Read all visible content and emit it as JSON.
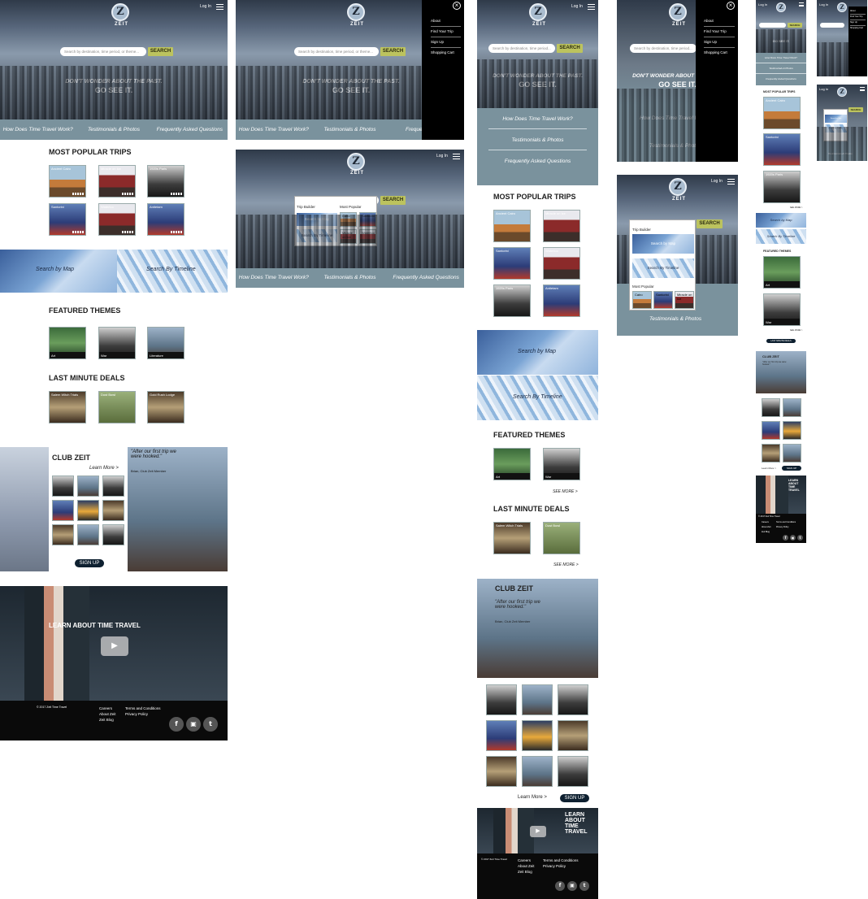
{
  "brand": {
    "logo_letter": "Z",
    "name": "ZEIT"
  },
  "header": {
    "login": "Log In"
  },
  "search": {
    "placeholder": "Search by destination, time period, or theme...",
    "placeholder_short": "Search by destination, time period...",
    "button": "SEARCH"
  },
  "hero": {
    "line1": "DON'T WONDER ABOUT THE PAST.",
    "line2": "GO SEE IT."
  },
  "nav": {
    "how": "How Does Time Travel Work?",
    "testimonials": "Testimonials & Photos",
    "faq": "Frequently Asked Questions",
    "faq_short": "Frequently Asked"
  },
  "menu": {
    "items": [
      "About",
      "Find Your Trip",
      "Sign Up",
      "Shopping Cart"
    ],
    "close": "×"
  },
  "dropdown": {
    "builder": "Trip Builder",
    "popular": "Most Popular",
    "by_map": "Search by Map",
    "by_timeline": "Search By Timeline",
    "cairo": "Cairo",
    "santorini": "Santorini",
    "miracle": "Miracle on Ice",
    "waterloo": "Waterloo"
  },
  "popular": {
    "title": "MOST POPULAR TRIPS",
    "trips": [
      "Ancient Cairo",
      "Miracle on Ice",
      "1920s Paris",
      "Santorini",
      "Waterloo",
      "Antietam"
    ]
  },
  "search_modes": {
    "map": "Search by Map",
    "timeline": "Search By Timeline"
  },
  "themes": {
    "title": "FEATURED THEMES",
    "items": [
      "Art",
      "War",
      "Literature"
    ],
    "see_more": "SEE MORE >"
  },
  "deals": {
    "title": "LAST MINUTE DEALS",
    "items": [
      "Salem Witch Trials",
      "Dust Bowl",
      "Gold Rush Lodge"
    ],
    "see_more": "SEE MORE >"
  },
  "club": {
    "title": "CLUB ZEIT",
    "learn_more": "Learn More >",
    "quote": "\"After our first trip we were hooked.\"",
    "author": "Brian, Club Zeit Member",
    "signup": "SIGN UP"
  },
  "video": {
    "title": "LEARN ABOUT TIME TRAVEL",
    "play": "▶"
  },
  "footer": {
    "copyright": "© 2017 Zeit Time Travel",
    "links_a": [
      "Careers",
      "About Zeit",
      "Zeit Blog"
    ],
    "links_b": [
      "Terms and Conditions",
      "Privacy Policy"
    ],
    "social": [
      "f",
      "▣",
      "t"
    ]
  },
  "mobile": {
    "popular_title": "MOST POPULAR TRIPS",
    "themes_title": "FEATURED THEMES",
    "deals_btn": "LAST MINUTE DEALS",
    "club_title": "CLUB ZEIT",
    "see_more": "SEE MORE >"
  }
}
